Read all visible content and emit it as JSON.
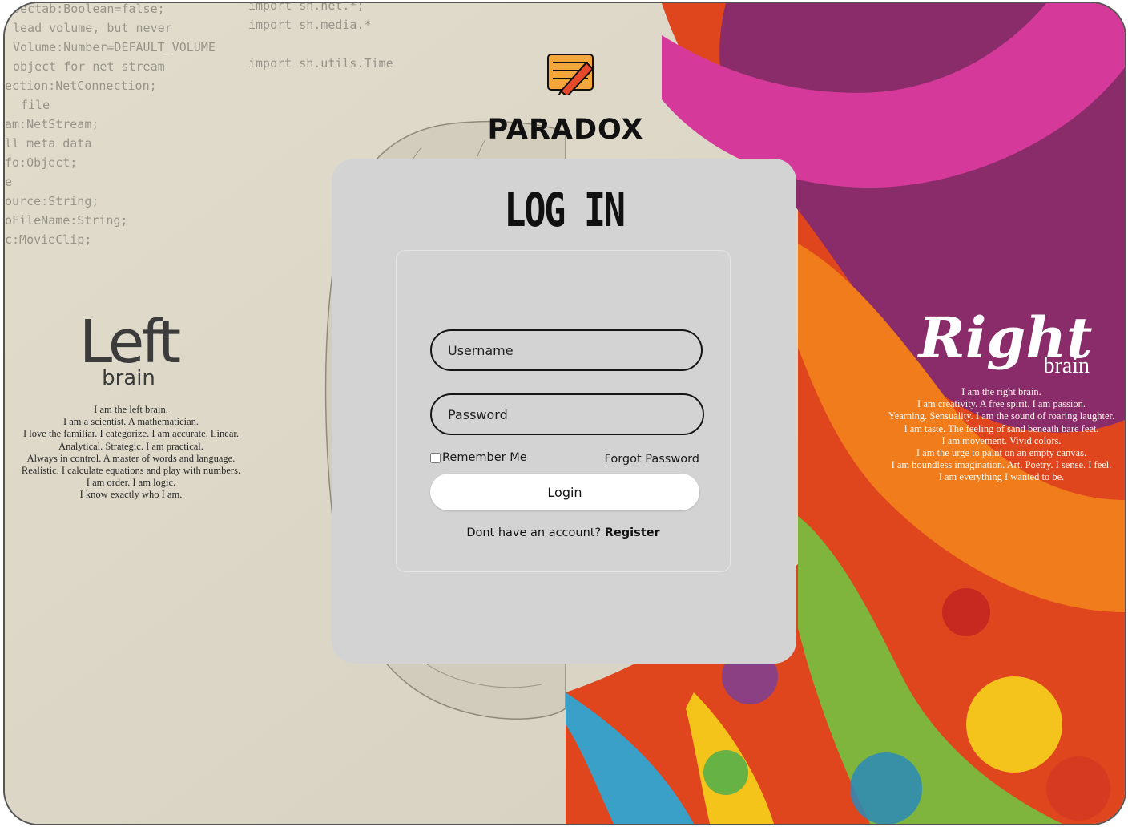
{
  "brand": {
    "name": "PARADOX",
    "logo_icon": "pencil-notepad-icon"
  },
  "background": {
    "left": {
      "title": "Left",
      "subtitle": "brain",
      "lines": [
        "I am the left brain.",
        "I am a scientist. A mathematician.",
        "I love the familiar. I categorize. I am accurate. Linear.",
        "Analytical. Strategic. I am practical.",
        "Always in control. A master of words and language.",
        "Realistic. I calculate equations and play with numbers.",
        "I am order. I am logic.",
        "I know exactly who I am."
      ]
    },
    "right": {
      "title": "Right",
      "subtitle": "brain",
      "lines": [
        "I am the right brain.",
        "I am creativity. A free spirit. I am passion.",
        "Yearning. Sensuality. I am the sound of roaring laughter.",
        "I am taste. The feeling of sand beneath bare feet.",
        "I am movement. Vivid colors.",
        "I am the urge to paint on an empty canvas.",
        "I am boundless imagination. Art. Poetry. I sense. I feel.",
        "I am everything I wanted to be."
      ]
    },
    "code_lines": [
      "sectab:Boolean=false;",
      "lead volume, but never",
      "Volume:Number=DEFAULT_VOLUME",
      "object for net stream",
      "ection:NetConnection;",
      "file",
      "am:NetStream;",
      "ll meta data",
      "fo:Object;",
      "e",
      "ource:String;",
      "oFileName:String;",
      "c:MovieClip;"
    ],
    "code_imports": [
      "import sh.net.*;",
      "import sh.media.*",
      "import sh.utils.Time"
    ]
  },
  "login": {
    "title": "LOG IN",
    "username_placeholder": "Username",
    "password_placeholder": "Password",
    "remember_label": "Remember Me",
    "forgot_label": "Forgot Password",
    "login_button": "Login",
    "register_prompt": "Dont have an account?",
    "register_link": "Register"
  },
  "colors": {
    "card": "#d3d3d3",
    "button": "#ffffff",
    "text": "#111111"
  }
}
